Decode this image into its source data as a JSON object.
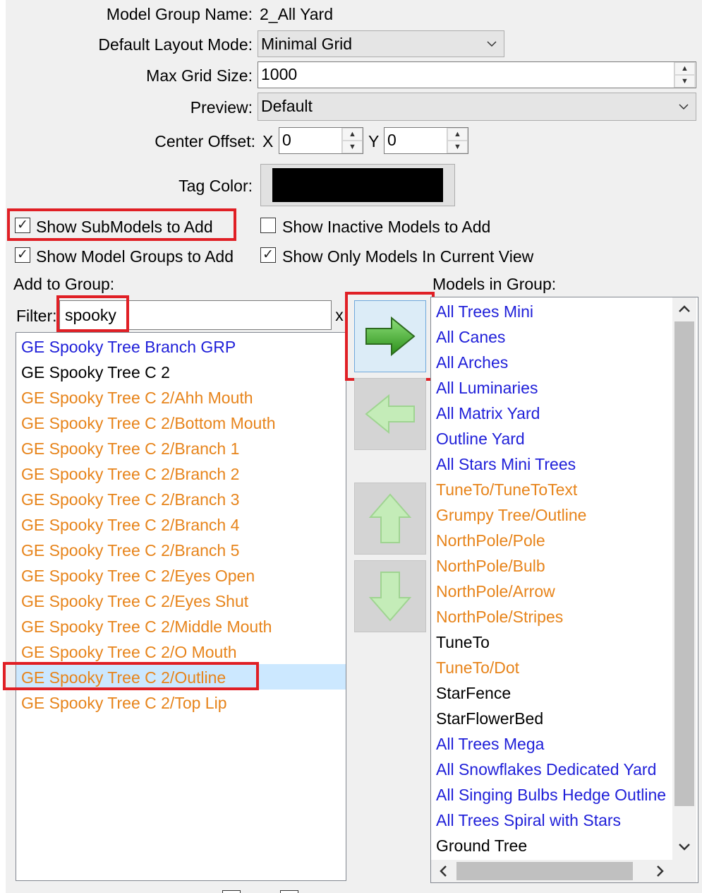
{
  "form": {
    "model_group_name_label": "Model Group Name:",
    "model_group_name_value": "2_All Yard",
    "default_layout_label": "Default Layout Mode:",
    "default_layout_value": "Minimal Grid",
    "max_grid_label": "Max Grid Size:",
    "max_grid_value": "1000",
    "preview_label": "Preview:",
    "preview_value": "Default",
    "center_offset_label": "Center Offset:",
    "x_label": "X",
    "x_value": "0",
    "y_label": "Y",
    "y_value": "0",
    "tag_color_label": "Tag Color:",
    "tag_color": "#000000"
  },
  "options": {
    "show_submodels": {
      "label": "Show SubModels to Add",
      "checked": true
    },
    "show_inactive": {
      "label": "Show Inactive Models to Add",
      "checked": false
    },
    "show_model_groups": {
      "label": "Show Model Groups to Add",
      "checked": true
    },
    "show_only_current_view": {
      "label": "Show Only Models In Current View",
      "checked": true
    }
  },
  "add_to_group": {
    "header": "Add to Group:",
    "filter_label": "Filter:",
    "filter_value": "spooky",
    "clear_label": "x",
    "items": [
      {
        "text": "GE Spooky Tree Branch GRP",
        "color": "blue"
      },
      {
        "text": "GE Spooky Tree C 2",
        "color": "black"
      },
      {
        "text": "GE Spooky Tree C 2/Ahh Mouth",
        "color": "orange"
      },
      {
        "text": "GE Spooky Tree C 2/Bottom Mouth",
        "color": "orange"
      },
      {
        "text": "GE Spooky Tree C 2/Branch 1",
        "color": "orange"
      },
      {
        "text": "GE Spooky Tree C 2/Branch 2",
        "color": "orange"
      },
      {
        "text": "GE Spooky Tree C 2/Branch 3",
        "color": "orange"
      },
      {
        "text": "GE Spooky Tree C 2/Branch 4",
        "color": "orange"
      },
      {
        "text": "GE Spooky Tree C 2/Branch 5",
        "color": "orange"
      },
      {
        "text": "GE Spooky Tree C 2/Eyes Open",
        "color": "orange"
      },
      {
        "text": "GE Spooky Tree C 2/Eyes Shut",
        "color": "orange"
      },
      {
        "text": "GE Spooky Tree C 2/Middle Mouth",
        "color": "orange"
      },
      {
        "text": "GE Spooky Tree C 2/O Mouth",
        "color": "orange"
      },
      {
        "text": "GE Spooky Tree C 2/Outline",
        "color": "orange",
        "selected": true
      },
      {
        "text": "GE Spooky Tree C 2/Top Lip",
        "color": "orange"
      }
    ]
  },
  "models_in_group": {
    "header": "Models in Group:",
    "items": [
      {
        "text": "All Trees Mini",
        "color": "blue"
      },
      {
        "text": "All Canes",
        "color": "blue"
      },
      {
        "text": "All Arches",
        "color": "blue"
      },
      {
        "text": "All Luminaries",
        "color": "blue"
      },
      {
        "text": "All Matrix Yard",
        "color": "blue"
      },
      {
        "text": "Outline Yard",
        "color": "blue"
      },
      {
        "text": "All Stars Mini Trees",
        "color": "blue"
      },
      {
        "text": "TuneTo/TuneToText",
        "color": "orange"
      },
      {
        "text": "Grumpy Tree/Outline",
        "color": "orange"
      },
      {
        "text": "NorthPole/Pole",
        "color": "orange"
      },
      {
        "text": "NorthPole/Bulb",
        "color": "orange"
      },
      {
        "text": "NorthPole/Arrow",
        "color": "orange"
      },
      {
        "text": "NorthPole/Stripes",
        "color": "orange"
      },
      {
        "text": "TuneTo",
        "color": "black"
      },
      {
        "text": "TuneTo/Dot",
        "color": "orange"
      },
      {
        "text": "StarFence",
        "color": "black"
      },
      {
        "text": "StarFlowerBed",
        "color": "black"
      },
      {
        "text": "All Trees Mega",
        "color": "blue"
      },
      {
        "text": "All Snowflakes Dedicated Yard",
        "color": "blue"
      },
      {
        "text": "All Singing Bulbs Hedge Outline",
        "color": "blue"
      },
      {
        "text": "All Trees Spiral with Stars",
        "color": "blue"
      },
      {
        "text": "Ground Tree",
        "color": "black"
      }
    ]
  },
  "colors": {
    "blue": "#1f1fd9",
    "orange": "#e7841b",
    "highlight": "#e01f25",
    "selection": "#cce8ff"
  }
}
